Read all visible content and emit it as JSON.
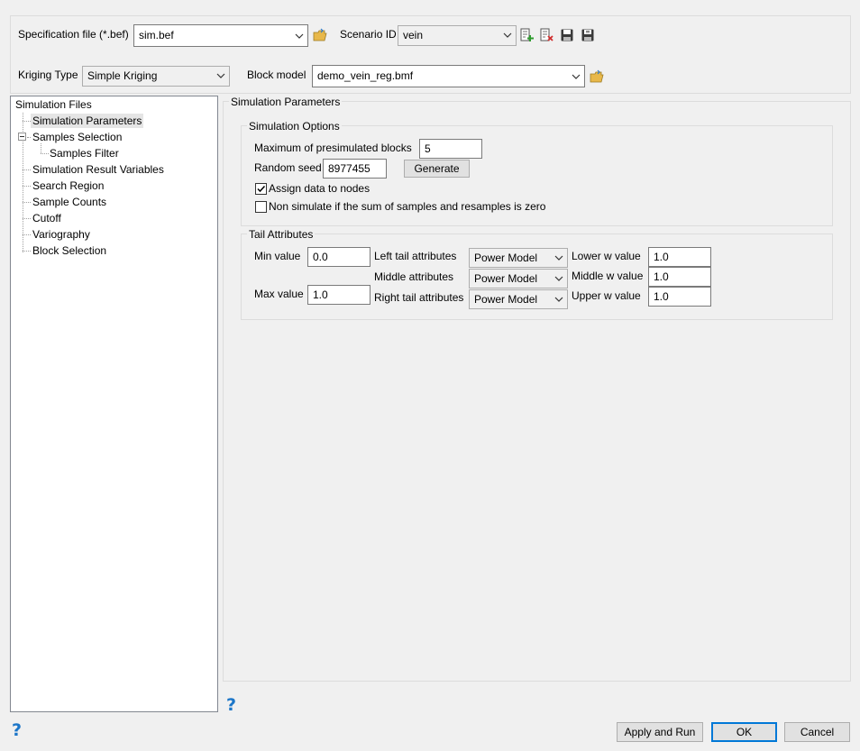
{
  "header": {
    "spec_file_label": "Specification file (*.bef)",
    "spec_file_value": "sim.bef",
    "scenario_label": "Scenario ID",
    "scenario_value": "vein",
    "kriging_label": "Kriging Type",
    "kriging_value": "Simple Kriging",
    "block_model_label": "Block model",
    "block_model_value": "demo_vein_reg.bmf",
    "icons": [
      "folder-open-icon",
      "add-scenario-icon",
      "delete-scenario-icon",
      "save-icon",
      "save-as-icon"
    ]
  },
  "tree": {
    "items": [
      {
        "label": "Simulation Files"
      },
      {
        "label": "Simulation Parameters"
      },
      {
        "label": "Samples Selection"
      },
      {
        "label": "Samples Filter"
      },
      {
        "label": "Simulation Result Variables"
      },
      {
        "label": "Search Region"
      },
      {
        "label": "Sample Counts"
      },
      {
        "label": "Cutoff"
      },
      {
        "label": "Variography"
      },
      {
        "label": "Block Selection"
      }
    ],
    "selected": "Simulation Parameters"
  },
  "panel": {
    "title": "Simulation Parameters",
    "options": {
      "title": "Simulation Options",
      "max_presim_label": "Maximum of presimulated blocks",
      "max_presim_value": "5",
      "seed_label": "Random seed",
      "seed_value": "8977455",
      "generate_label": "Generate",
      "assign_label": "Assign data to nodes",
      "assign_checked": true,
      "nonsim_label": "Non simulate if the sum of samples and resamples is zero",
      "nonsim_checked": false
    },
    "tail": {
      "title": "Tail Attributes",
      "min_label": "Min value",
      "min_value": "0.0",
      "max_label": "Max value",
      "max_value": "1.0",
      "left_label": "Left tail attributes",
      "left_value": "Power Model",
      "middle_label": "Middle attributes",
      "middle_value": "Power Model",
      "right_label": "Right tail attributes",
      "right_value": "Power Model",
      "lower_w_label": "Lower w value",
      "lower_w_value": "1.0",
      "middle_w_label": "Middle w value",
      "middle_w_value": "1.0",
      "upper_w_label": "Upper w value",
      "upper_w_value": "1.0"
    }
  },
  "footer": {
    "help_glyph": "?",
    "apply_label": "Apply and Run",
    "ok_label": "OK",
    "cancel_label": "Cancel"
  },
  "colors": {
    "help": "#1c76c8",
    "folder": "#e8b84a",
    "accent": "#0078d7"
  }
}
